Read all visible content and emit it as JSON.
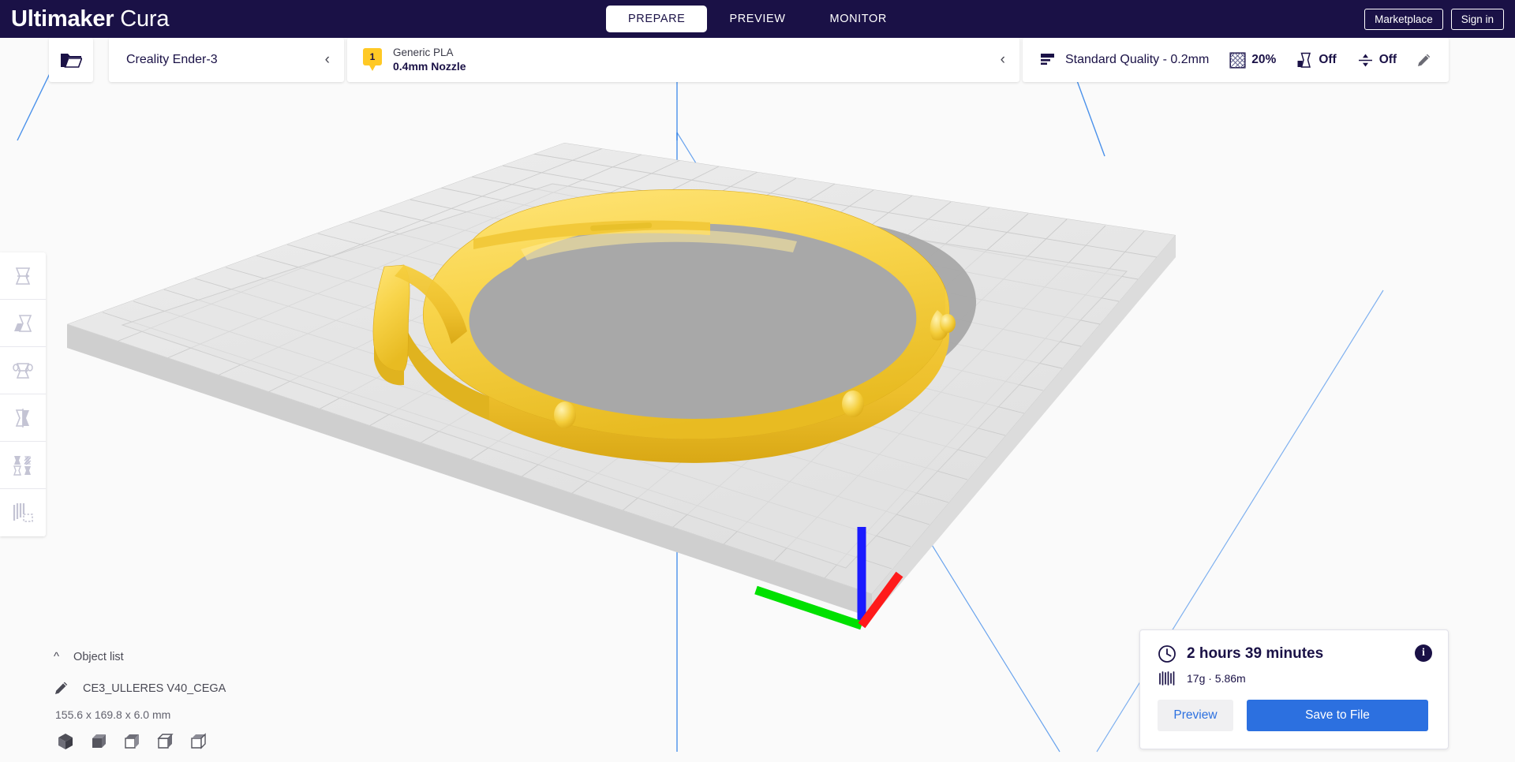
{
  "app": {
    "brand_bold": "Ultimaker",
    "brand_light": "Cura",
    "accent_navy": "#1a1146",
    "accent_blue": "#2c70e0",
    "accent_yellow": "#ffc925"
  },
  "tabs": [
    {
      "label": "PREPARE",
      "active": true
    },
    {
      "label": "PREVIEW",
      "active": false
    },
    {
      "label": "MONITOR",
      "active": false
    }
  ],
  "topright": {
    "marketplace": "Marketplace",
    "signin": "Sign in"
  },
  "stagebar": {
    "open_file_icon": "open-folder-icon",
    "machine": {
      "name": "Creality Ender-3",
      "collapse_icon": "chevron-left-icon"
    },
    "material": {
      "extruder_number": "1",
      "type": "Generic PLA",
      "nozzle": "0.4mm Nozzle",
      "collapse_icon": "chevron-left-icon"
    },
    "print_settings": {
      "quality_icon": "layer-height-icon",
      "quality": "Standard Quality - 0.2mm",
      "infill_icon": "infill-icon",
      "infill": "20%",
      "support_icon": "support-icon",
      "support": "Off",
      "adhesion_icon": "adhesion-icon",
      "adhesion": "Off",
      "edit_icon": "pencil-icon"
    }
  },
  "toolbar": [
    {
      "name": "move-tool",
      "icon": "move-icon"
    },
    {
      "name": "scale-tool",
      "icon": "scale-icon"
    },
    {
      "name": "rotate-tool",
      "icon": "rotate-icon"
    },
    {
      "name": "mirror-tool",
      "icon": "mirror-icon"
    },
    {
      "name": "per-model-settings-tool",
      "icon": "per-model-settings-icon"
    },
    {
      "name": "support-blocker-tool",
      "icon": "support-blocker-icon"
    }
  ],
  "object_list": {
    "caret_icon": "chevron-up-icon",
    "title": "Object list",
    "item_icon": "pencil-icon",
    "item_name": "CE3_ULLERES V40_CEGA",
    "dimensions": "155.6 x 169.8 x 6.0 mm"
  },
  "view_cubes": [
    {
      "name": "view-3d",
      "label": "3D view"
    },
    {
      "name": "view-front",
      "label": "Front view"
    },
    {
      "name": "view-top",
      "label": "Top view"
    },
    {
      "name": "view-left",
      "label": "Left view"
    },
    {
      "name": "view-right",
      "label": "Right view"
    }
  ],
  "print_info": {
    "clock_icon": "clock-icon",
    "time": "2 hours 39 minutes",
    "info_icon": "info-icon",
    "info_glyph": "i",
    "spool_icon": "filament-icon",
    "material": "17g · 5.86m",
    "preview_label": "Preview",
    "save_label": "Save to File"
  },
  "viewport": {
    "model_color": "#f5cf3c",
    "plate_color": "#d9d9d9",
    "build_volume_line": "#2c7fe8",
    "axis_x_color": "#ff1a1a",
    "axis_y_color": "#00e000",
    "axis_z_color": "#1a1aff"
  }
}
